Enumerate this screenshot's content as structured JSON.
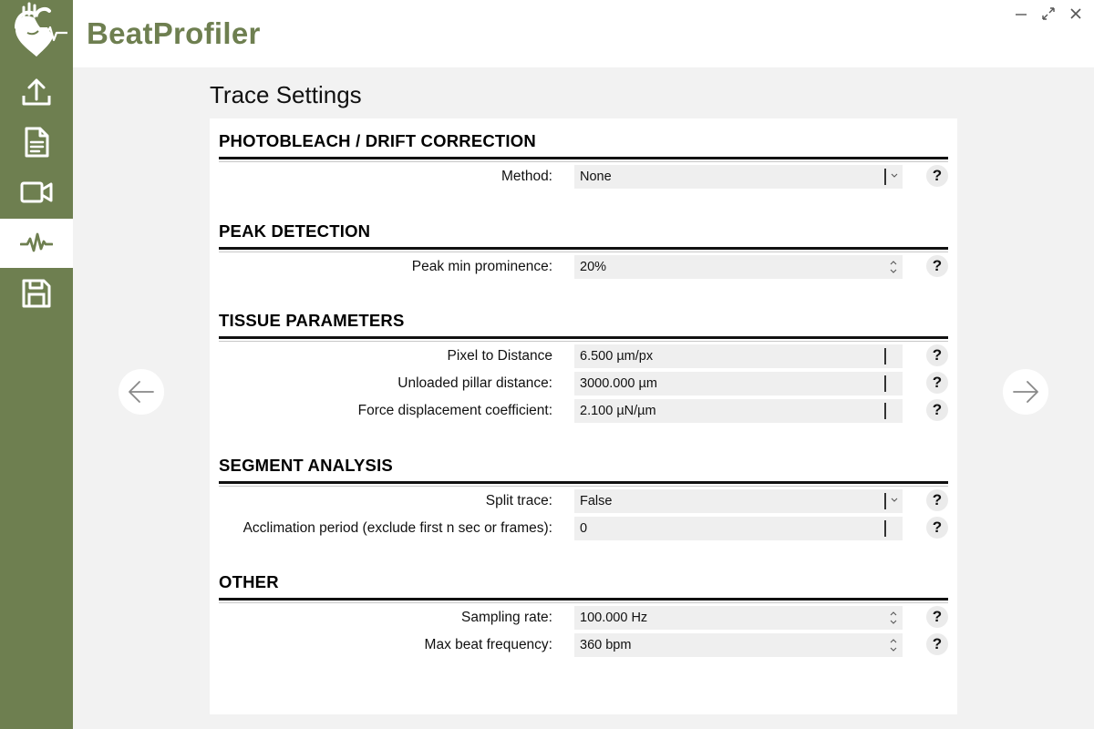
{
  "app": {
    "title": "BeatProfiler"
  },
  "colors": {
    "accent": "#6e7f50",
    "sidebar_bg": "#6e7f50",
    "panel_bg": "#ffffff",
    "page_bg": "#f2f2f2"
  },
  "sidebar": {
    "items": [
      {
        "icon": "upload-icon",
        "active": false
      },
      {
        "icon": "document-icon",
        "active": false
      },
      {
        "icon": "video-camera-icon",
        "active": false
      },
      {
        "icon": "heartbeat-trace-icon",
        "active": true
      },
      {
        "icon": "save-icon",
        "active": false
      }
    ]
  },
  "window_controls": [
    "minimize-icon",
    "maximize-icon",
    "close-icon"
  ],
  "page": {
    "title": "Trace Settings"
  },
  "sections": [
    {
      "title": "PHOTOBLEACH / DRIFT CORRECTION",
      "rows": [
        {
          "label": "Method:",
          "value": "None",
          "control": "dropdown"
        }
      ]
    },
    {
      "title": "PEAK DETECTION",
      "rows": [
        {
          "label": "Peak min prominence:",
          "value": "20%",
          "control": "spinbox"
        }
      ]
    },
    {
      "title": "TISSUE PARAMETERS",
      "rows": [
        {
          "label": "Pixel to Distance",
          "value": "6.500 µm/px",
          "control": "text"
        },
        {
          "label": "Unloaded pillar distance:",
          "value": "3000.000 µm",
          "control": "text"
        },
        {
          "label": "Force displacement coefficient:",
          "value": "2.100 µN/µm",
          "control": "text"
        }
      ]
    },
    {
      "title": "SEGMENT ANALYSIS",
      "rows": [
        {
          "label": "Split trace:",
          "value": "False",
          "control": "dropdown"
        },
        {
          "label": "Acclimation period (exclude first n sec or frames):",
          "value": "0",
          "control": "text"
        }
      ]
    },
    {
      "title": "OTHER",
      "rows": [
        {
          "label": "Sampling rate:",
          "value": "100.000 Hz",
          "control": "spinbox"
        },
        {
          "label": "Max beat frequency:",
          "value": "360 bpm",
          "control": "spinbox"
        }
      ]
    }
  ],
  "help": {
    "label": "?"
  },
  "navigation": {
    "prev_icon": "arrow-left-icon",
    "next_icon": "arrow-right-icon"
  }
}
